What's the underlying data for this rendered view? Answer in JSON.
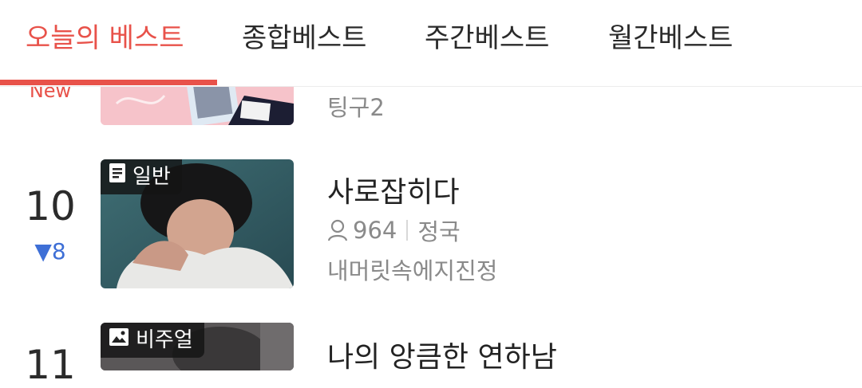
{
  "tabs": [
    {
      "label": "오늘의 베스트"
    },
    {
      "label": "종합베스트"
    },
    {
      "label": "주간베스트"
    },
    {
      "label": "월간베스트"
    }
  ],
  "rows": [
    {
      "rank_badge": "New",
      "title": "",
      "meta_sub": "팅구2"
    },
    {
      "rank": "10",
      "rank_change": "▼8",
      "badge_label": "일반",
      "badge_icon": "document-icon",
      "title": "사로잡히다",
      "views": "964",
      "author": "정국",
      "meta_sub": "내머릿속에지진정"
    },
    {
      "rank": "11",
      "badge_label": "비주얼",
      "badge_icon": "image-icon",
      "title": "나의 앙큼한 연하남"
    }
  ],
  "colors": {
    "accent": "#e8524a",
    "down_change": "#3e6fd6",
    "meta_text": "#8a8a8a"
  }
}
